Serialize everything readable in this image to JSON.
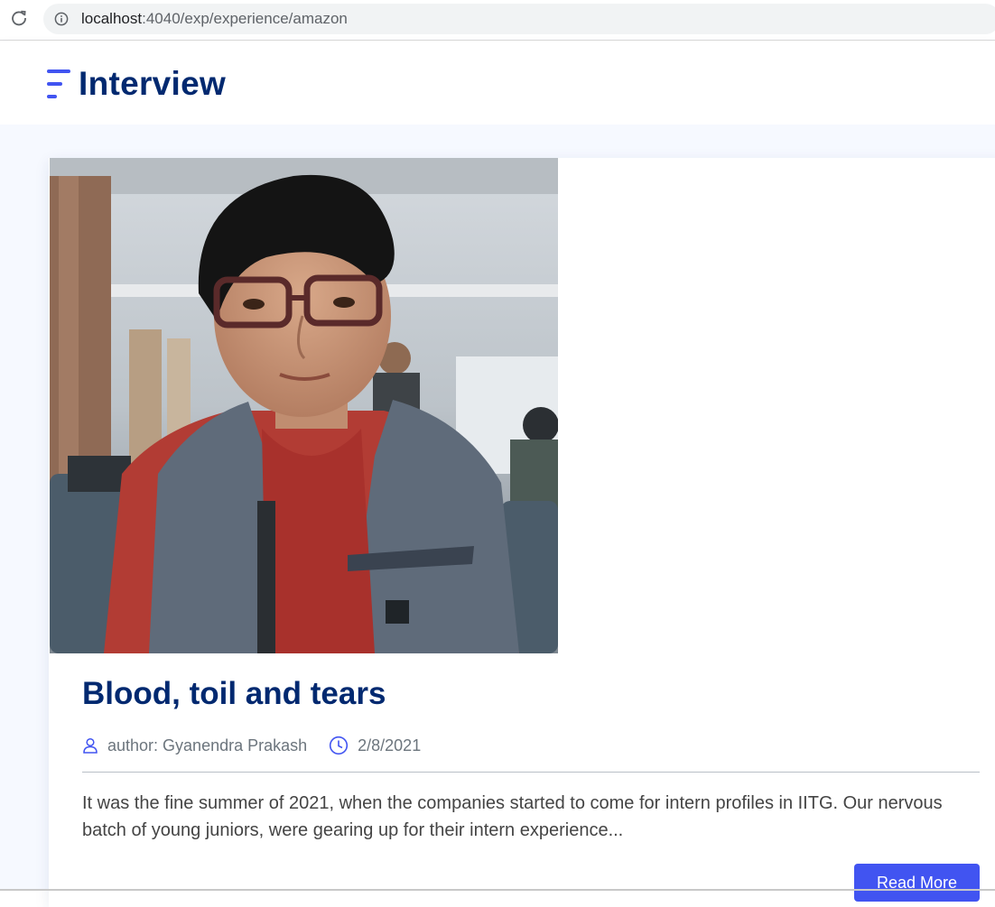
{
  "browser": {
    "url_host": "localhost",
    "url_path": ":4040/exp/experience/amazon"
  },
  "header": {
    "logo_text": "Interview"
  },
  "post": {
    "title": "Blood, toil and tears",
    "author": "author: Gyanendra Prakash",
    "date": "2/8/2021",
    "excerpt": "It was the fine summer of 2021, when the companies started to come for intern profiles in IITG. Our nervous batch of young juniors, were gearing up for their intern experience...",
    "read_more_label": "Read More"
  },
  "icons": {
    "reload": "reload-icon",
    "info": "info-icon",
    "logo": "logo-lines-icon",
    "author": "person-icon",
    "date": "clock-icon"
  },
  "colors": {
    "brand_navy": "#012970",
    "accent_blue": "#4154f1",
    "meta_gray": "#6c757d",
    "page_bg": "#f6f9ff"
  }
}
